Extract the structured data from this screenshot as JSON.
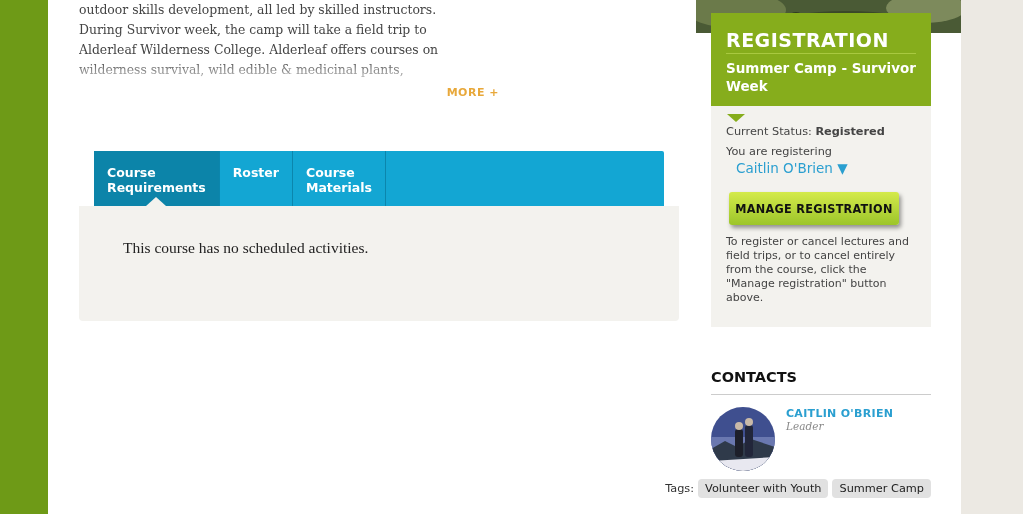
{
  "description": {
    "text": "outdoor skills development, all led by skilled instructors.\nDuring Survivor week, the camp will take a field trip to\nAlderleaf Wilderness College. Alderleaf offers courses on\nwilderness survival, wild edible & medicinal plants,",
    "more_link": "MORE +"
  },
  "tabs": [
    {
      "label": "Course\nRequirements",
      "selected": true
    },
    {
      "label": "Roster",
      "selected": false
    },
    {
      "label": "Course\nMaterials",
      "selected": false
    }
  ],
  "tab_content": "This course has no scheduled activities.",
  "registration": {
    "title": "REGISTRATION",
    "course": "Summer Camp - Survivor Week",
    "status_label": "Current Status:",
    "status": "Registered",
    "registering_label": "You are registering",
    "registrant": "Caitlin O'Brien ▼",
    "button": "MANAGE REGISTRATION",
    "note": "To register or cancel lectures and field trips, or to cancel entirely from the course, click the \"Manage registration\" button above."
  },
  "contacts": {
    "heading": "CONTACTS",
    "people": [
      {
        "name": "CAITLIN O'BRIEN",
        "role": "Leader",
        "kind": "picture"
      }
    ]
  },
  "tags": {
    "label": "Tags:",
    "items": [
      "Volunteer with Youth",
      "Summer Camp"
    ]
  }
}
